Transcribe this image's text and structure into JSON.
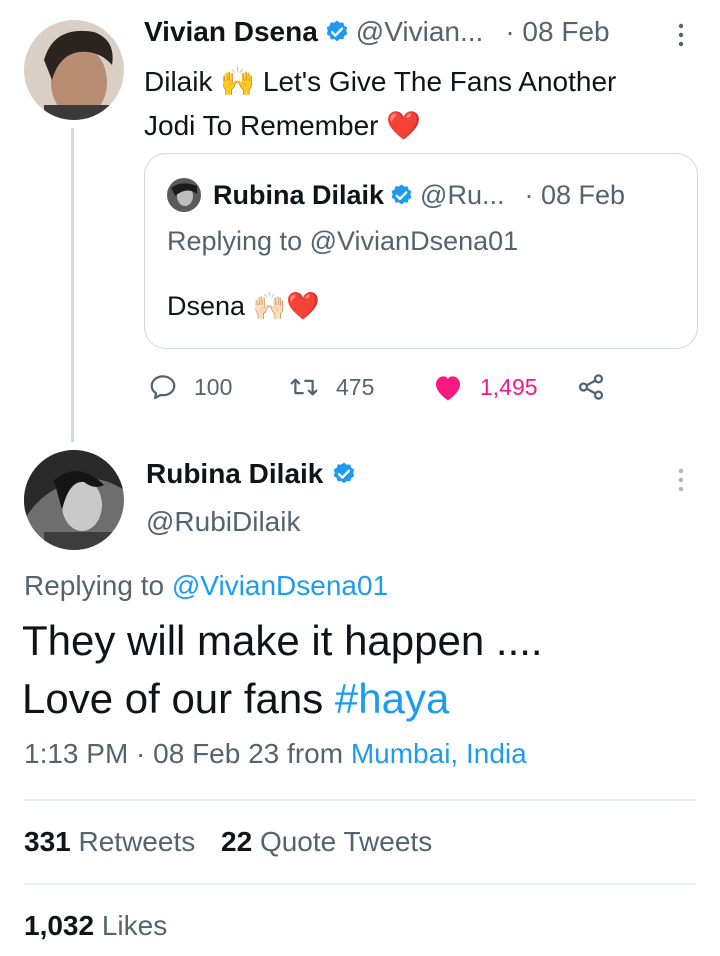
{
  "parent_tweet": {
    "name": "Vivian Dsena",
    "handle": "@Vivian...",
    "date": "· 08 Feb",
    "text_line1": "Dilaik 🙌 Let's Give The Fans Another",
    "text_line2": "Jodi To Remember ❤️",
    "quote": {
      "name": "Rubina Dilaik",
      "handle": "@Ru...",
      "date": "· 08 Feb",
      "replying_prefix": "Replying to",
      "replying_handle": "@VivianDsena01",
      "text": "Dsena 🙌🏻❤️"
    },
    "actions": {
      "replies": "100",
      "retweets": "475",
      "likes": "1,495"
    }
  },
  "main_tweet": {
    "name": "Rubina Dilaik",
    "handle": "@RubiDilaik",
    "replying_prefix": "Replying to",
    "replying_handle": "@VivianDsena01",
    "text_line1": "They will make it happen ....",
    "text_line2_prefix": "Love of our fans",
    "hashtag": "#haya",
    "time": "1:13 PM · 08 Feb 23 from",
    "location": "Mumbai, India",
    "retweets_count": "331",
    "retweets_label": "Retweets",
    "quotes_count": "22",
    "quotes_label": "Quote Tweets",
    "likes_count": "1,032",
    "likes_label": "Likes"
  },
  "colors": {
    "accent": "#1d9bf0",
    "like": "#f91880",
    "muted": "#536471"
  }
}
